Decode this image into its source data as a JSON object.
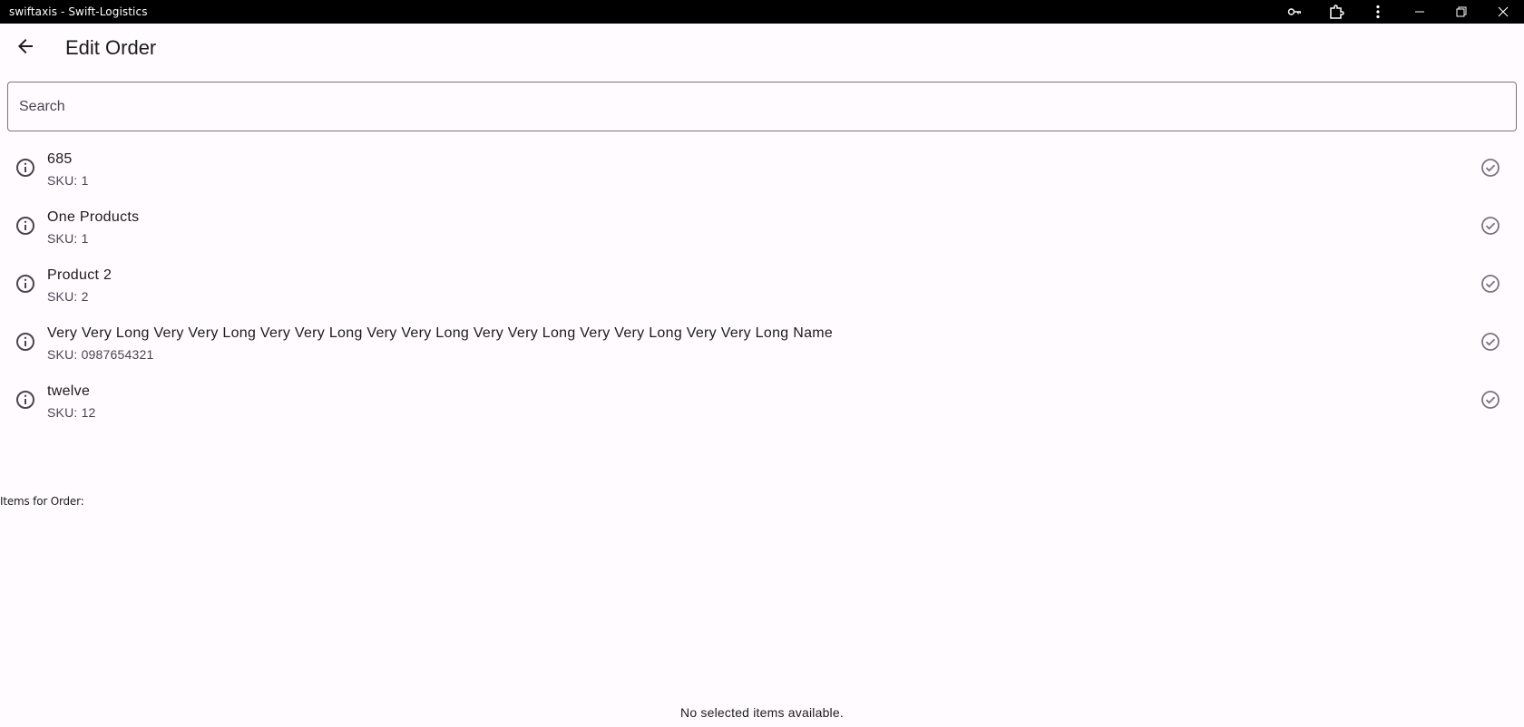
{
  "window": {
    "title": "swiftaxis - Swift-Logistics",
    "controls": [
      "key-icon",
      "extensions-icon",
      "more-vert-icon",
      "minimize-icon",
      "restore-icon",
      "close-icon"
    ]
  },
  "appbar": {
    "back_icon": "arrow-back-icon",
    "title": "Edit Order"
  },
  "search": {
    "placeholder": "Search",
    "value": ""
  },
  "products": [
    {
      "name": "685",
      "sku": "SKU: 1"
    },
    {
      "name": "One Products",
      "sku": "SKU: 1"
    },
    {
      "name": "Product 2",
      "sku": "SKU: 2"
    },
    {
      "name": "Very Very Long Very Very Long Very Very Long Very Very Long Very Very Long Very Very Long Very Very Long Name",
      "sku": "SKU: 0987654321"
    },
    {
      "name": "twelve",
      "sku": "SKU: 12"
    }
  ],
  "order_items": {
    "label": "Items for Order:",
    "empty_message": "No selected items available."
  },
  "colors": {
    "background": "#fffbff",
    "titlebar": "#000000",
    "icon": "#49454f",
    "check": "#79747e",
    "outline": "#79747e"
  }
}
